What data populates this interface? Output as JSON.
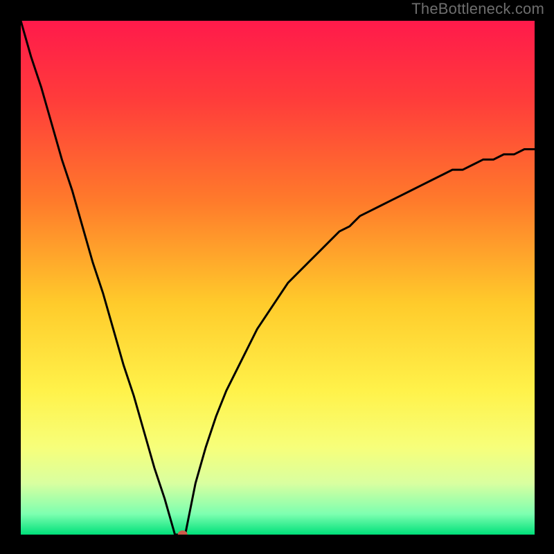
{
  "watermark": "TheBottleneck.com",
  "chart_data": {
    "type": "line",
    "title": "",
    "xlabel": "",
    "ylabel": "",
    "x": [
      0.0,
      0.02,
      0.04,
      0.06,
      0.08,
      0.1,
      0.12,
      0.14,
      0.16,
      0.18,
      0.2,
      0.22,
      0.24,
      0.26,
      0.28,
      0.3,
      0.32,
      0.34,
      0.36,
      0.38,
      0.4,
      0.42,
      0.44,
      0.46,
      0.48,
      0.5,
      0.52,
      0.54,
      0.56,
      0.58,
      0.6,
      0.62,
      0.64,
      0.66,
      0.68,
      0.7,
      0.72,
      0.74,
      0.76,
      0.78,
      0.8,
      0.82,
      0.84,
      0.86,
      0.88,
      0.9,
      0.92,
      0.94,
      0.96,
      0.98,
      1.0
    ],
    "values": [
      1.0,
      0.93,
      0.87,
      0.8,
      0.73,
      0.67,
      0.6,
      0.53,
      0.47,
      0.4,
      0.33,
      0.27,
      0.2,
      0.13,
      0.07,
      0.0,
      0.0,
      0.1,
      0.17,
      0.23,
      0.28,
      0.32,
      0.36,
      0.4,
      0.43,
      0.46,
      0.49,
      0.51,
      0.53,
      0.55,
      0.57,
      0.59,
      0.6,
      0.62,
      0.63,
      0.64,
      0.65,
      0.66,
      0.67,
      0.68,
      0.69,
      0.7,
      0.71,
      0.71,
      0.72,
      0.73,
      0.73,
      0.74,
      0.74,
      0.75,
      0.75
    ],
    "xlim": [
      0,
      1
    ],
    "ylim": [
      0,
      1
    ],
    "marker": {
      "x": 0.315,
      "y": 0.0
    },
    "gradient_stops": [
      {
        "offset": 0.0,
        "color": "#ff1a4b"
      },
      {
        "offset": 0.15,
        "color": "#ff3b3b"
      },
      {
        "offset": 0.35,
        "color": "#ff7a2b"
      },
      {
        "offset": 0.55,
        "color": "#ffcb2b"
      },
      {
        "offset": 0.72,
        "color": "#fff24a"
      },
      {
        "offset": 0.83,
        "color": "#f7ff7a"
      },
      {
        "offset": 0.9,
        "color": "#d9ffa0"
      },
      {
        "offset": 0.96,
        "color": "#7dffb0"
      },
      {
        "offset": 1.0,
        "color": "#00e07a"
      }
    ]
  }
}
